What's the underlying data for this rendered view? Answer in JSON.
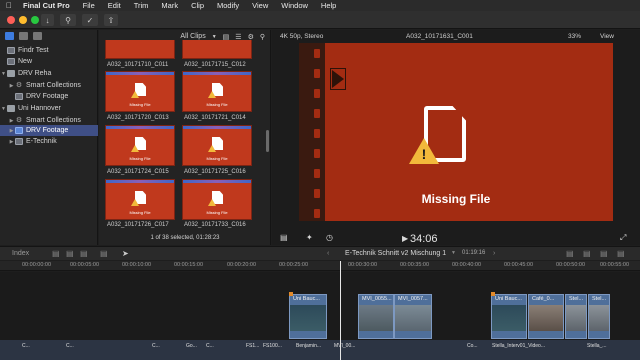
{
  "menubar": {
    "app": "Final Cut Pro",
    "items": [
      "File",
      "Edit",
      "Trim",
      "Mark",
      "Clip",
      "Modify",
      "View",
      "Window",
      "Help"
    ]
  },
  "sidebar": {
    "items": [
      {
        "label": "Findr Test",
        "level": 0,
        "icon": "event-icon"
      },
      {
        "label": "New",
        "level": 0,
        "icon": "event-icon"
      },
      {
        "label": "DRV Reha",
        "level": 0,
        "icon": "library-icon"
      },
      {
        "label": "Smart Collections",
        "level": 1,
        "icon": "smart-collection-icon"
      },
      {
        "label": "DRV Footage",
        "level": 1,
        "icon": "event-icon"
      },
      {
        "label": "Uni Hannover",
        "level": 0,
        "icon": "library-icon"
      },
      {
        "label": "Smart Collections",
        "level": 1,
        "icon": "smart-collection-icon"
      },
      {
        "label": "DRV Footage",
        "level": 1,
        "icon": "event-icon",
        "selected": true
      },
      {
        "label": "E-Technik",
        "level": 1,
        "icon": "event-icon"
      }
    ]
  },
  "browser": {
    "filter": "All Clips",
    "clips": [
      "A032_10171710_C011",
      "A032_10171715_C012",
      "A032_10171720_C013",
      "A032_10171721_C014",
      "A032_10171724_C015",
      "A032_10171725_C016",
      "A032_10171726_C017",
      "A032_10171733_C016"
    ],
    "missing_label": "Missing File",
    "footer": "1 of 38 selected, 01:28:23"
  },
  "viewer": {
    "format": "4K 50p, Stereo",
    "clip_name": "A032_10171631_C001",
    "zoom": "33%",
    "view_menu": "View",
    "missing_text": "Missing File",
    "timecode": "34:06"
  },
  "timeline": {
    "index_label": "Index",
    "project": "E-Technik Schnitt v2 Mischung 1",
    "duration": "01:19:16",
    "ruler": [
      "00:00:00:00",
      "00:00:05:00",
      "00:00:10:00",
      "00:00:15:00",
      "00:00:20:00",
      "00:00:25:00",
      "00:00:30:00",
      "00:00:35:00",
      "00:00:40:00",
      "00:00:45:00",
      "00:00:50:00",
      "00:00:55:00",
      "00:01:00:00"
    ],
    "clips_upper": [
      "Uni Bauc...",
      "MVI_0055...",
      "MVI_0057...",
      "Uni Bauc...",
      "Café_0...",
      "Stel...",
      "Stel..."
    ],
    "clips_lower": [
      "C...",
      "C...",
      "C...",
      "Go...",
      "C...",
      "FS1...",
      "FS100...",
      "Benjamin...",
      "MVI_00...",
      "Co...",
      "Stella_Interv01_Video...",
      "Stella_..."
    ]
  },
  "colors": {
    "missing_red": "#a32c12",
    "selection": "#3f4f86",
    "warning": "#f2b93b"
  }
}
